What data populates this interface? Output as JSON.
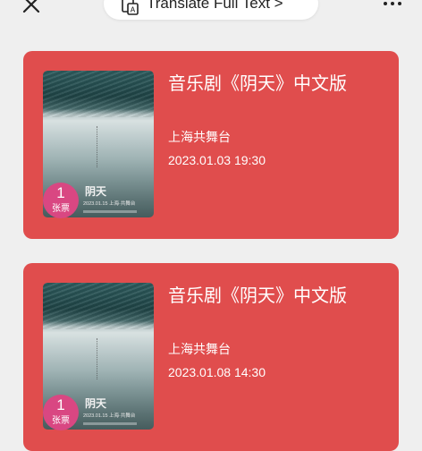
{
  "topbar": {
    "close_icon": "close-icon",
    "translate_icon": "translate-icon",
    "translate_label": "Translate Full Text >",
    "more_icon": "more-icon"
  },
  "colors": {
    "page_background": "#efefef",
    "card_background": "#e04d4d",
    "badge_background": "#d94782",
    "text": "#ffffff"
  },
  "orders": [
    {
      "title": "音乐剧《阴天》中文版",
      "venue": "上海共舞台",
      "datetime": "2023.01.03 19:30",
      "ticket_count": "1",
      "ticket_unit": "张票",
      "poster_title": "阴天",
      "poster_date": "2023.01.15 上海·共舞台"
    },
    {
      "title": "音乐剧《阴天》中文版",
      "venue": "上海共舞台",
      "datetime": "2023.01.08 14:30",
      "ticket_count": "1",
      "ticket_unit": "张票",
      "poster_title": "阴天",
      "poster_date": "2023.01.15 上海·共舞台"
    }
  ]
}
